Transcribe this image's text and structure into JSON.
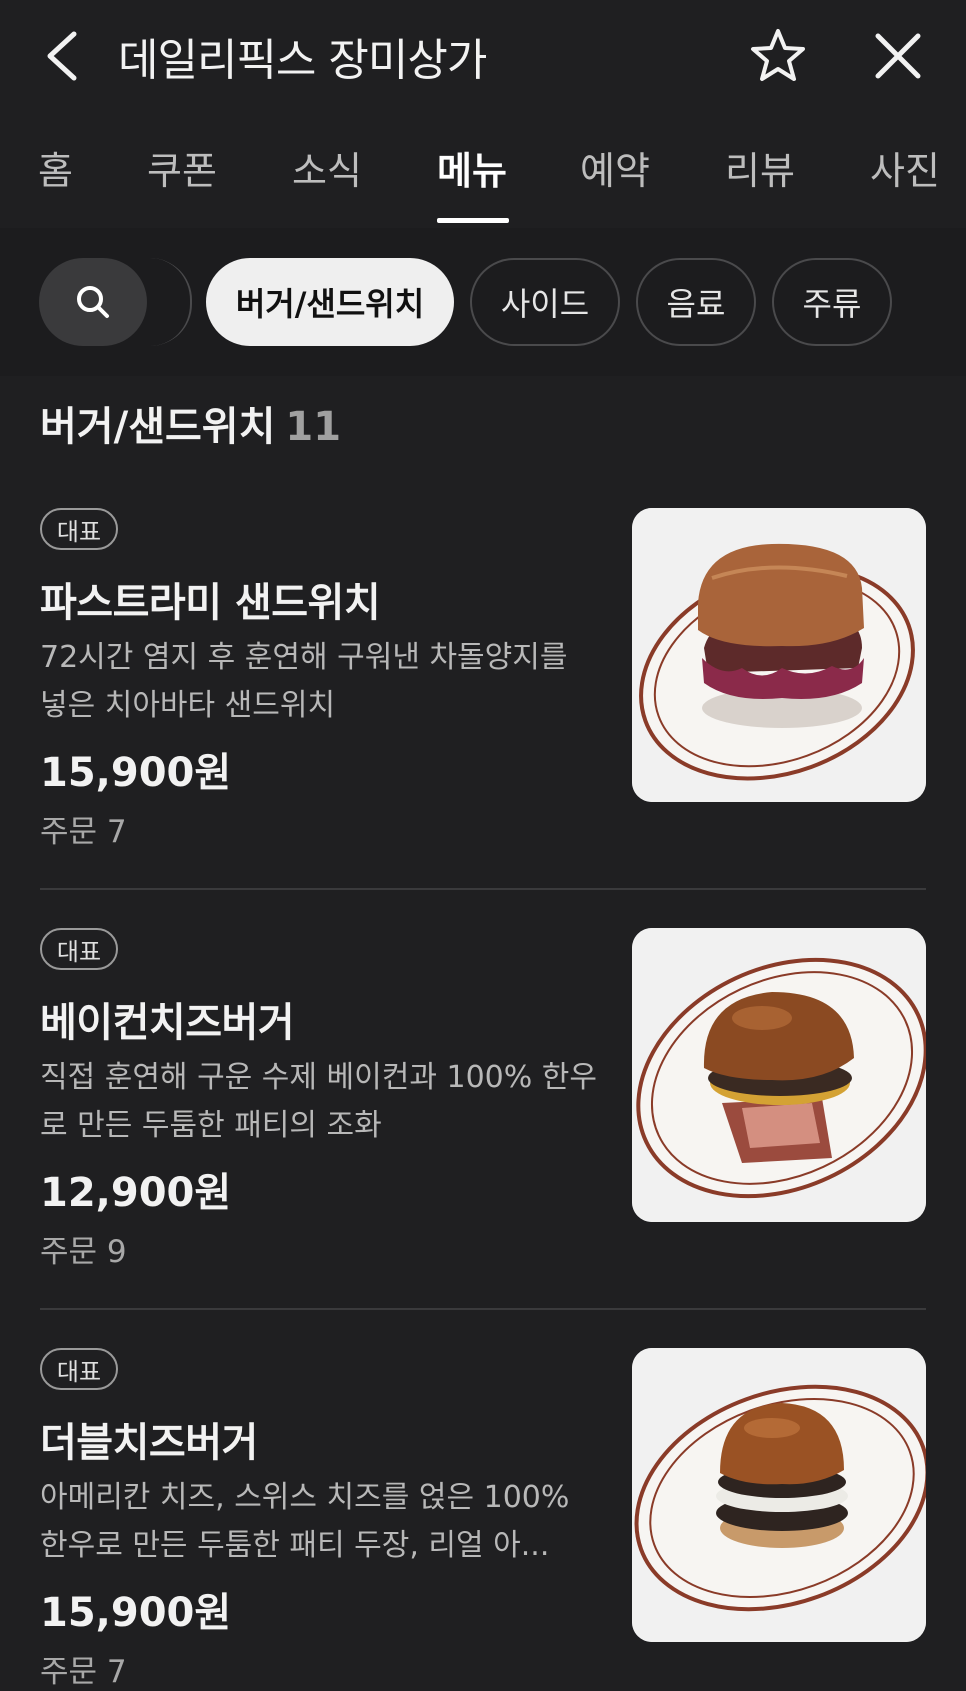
{
  "header": {
    "title": "데일리픽스 장미상가"
  },
  "tabs": [
    {
      "label": "홈"
    },
    {
      "label": "쿠폰"
    },
    {
      "label": "소식"
    },
    {
      "label": "메뉴"
    },
    {
      "label": "예약"
    },
    {
      "label": "리뷰"
    },
    {
      "label": "사진"
    }
  ],
  "active_tab": "메뉴",
  "filters": [
    {
      "label": "버거/샌드위치",
      "active": true
    },
    {
      "label": "사이드"
    },
    {
      "label": "음료"
    },
    {
      "label": "주류"
    }
  ],
  "section": {
    "title": "버거/샌드위치",
    "count": "11"
  },
  "items": [
    {
      "badge": "대표",
      "name": "파스트라미 샌드위치",
      "desc": "72시간 염지 후 훈연해 구워낸 차돌양지를 넣은 치아바타 샌드위치",
      "price": "15,900원",
      "orders": "주문 7"
    },
    {
      "badge": "대표",
      "name": "베이컨치즈버거",
      "desc": "직접 훈연해 구운 수제 베이컨과 100% 한우로 만든 두툼한 패티의 조화",
      "price": "12,900원",
      "orders": "주문 9"
    },
    {
      "badge": "대표",
      "name": "더블치즈버거",
      "desc": "아메리칸 치즈, 스위스 치즈를 얹은 100% 한우로 만든 두툼한 패티 두장, 리얼 아...",
      "price": "15,900원",
      "orders": "주문 7"
    }
  ],
  "icons": {
    "back": "chevron-left-icon",
    "favorite": "star-outline-icon",
    "close": "close-icon",
    "search": "search-icon"
  },
  "colors": {
    "background": "#1f1f21",
    "text": "#f2f2f2",
    "muted": "#b8b8b8",
    "chip_active": "#efefef"
  }
}
